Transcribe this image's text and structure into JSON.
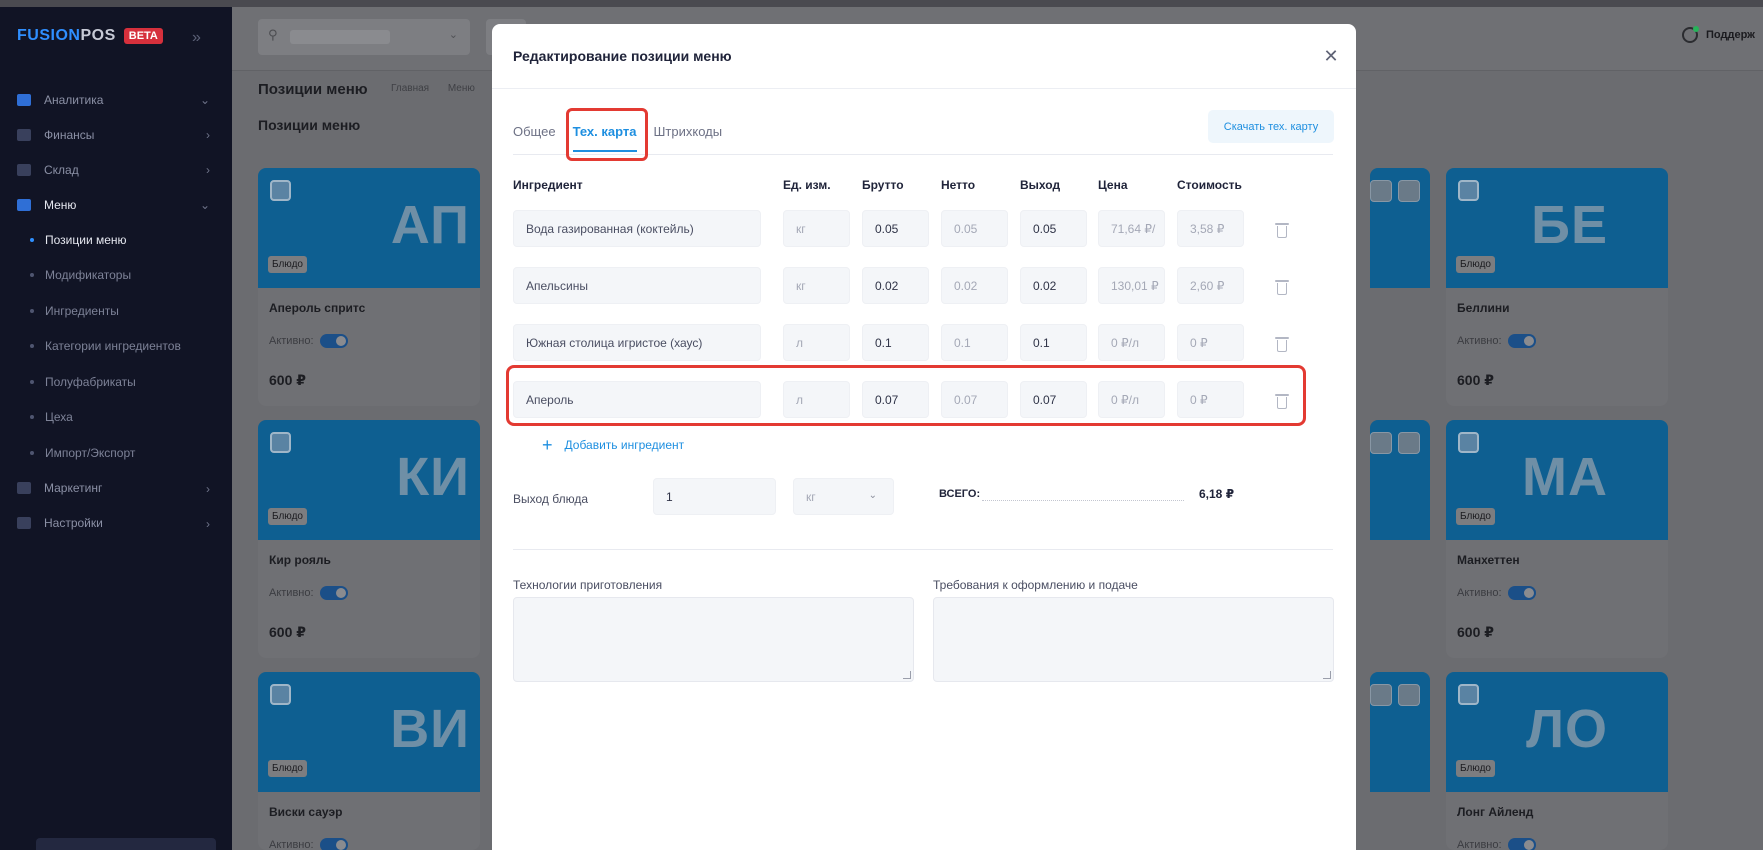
{
  "brand": {
    "name_a": "FUSION",
    "name_b": "POS",
    "badge": "BETA"
  },
  "sidebar": {
    "items": [
      {
        "label": "Аналитика",
        "arrow": "⌄"
      },
      {
        "label": "Финансы",
        "arrow": "›"
      },
      {
        "label": "Склад",
        "arrow": "›"
      },
      {
        "label": "Меню",
        "arrow": "⌄"
      }
    ],
    "sub_items": [
      "Позиции меню",
      "Модификаторы",
      "Ингредиенты",
      "Категории ингредиентов",
      "Полуфабрикаты",
      "Цеха",
      "Импорт/Экспорт"
    ],
    "items_after": [
      {
        "label": "Маркетинг",
        "arrow": "›"
      },
      {
        "label": "Настройки",
        "arrow": "›"
      }
    ]
  },
  "header": {
    "support": "Поддерж",
    "page_title": "Позиции меню",
    "breadcrumbs": [
      "Главная",
      "Меню"
    ],
    "section_title": "Позиции меню"
  },
  "cards": [
    {
      "letters": "АП",
      "badge": "Блюдо",
      "name": "Апероль спритс",
      "active_label": "Активно:",
      "price": "600 ₽"
    },
    {
      "letters": "БЕ",
      "badge": "Блюдо",
      "name": "Беллини",
      "active_label": "Активно:",
      "price": "600 ₽"
    },
    {
      "letters": "КИ",
      "badge": "Блюдо",
      "name": "Кир рояль",
      "active_label": "Активно:",
      "price": "600 ₽"
    },
    {
      "letters": "МА",
      "badge": "Блюдо",
      "name": "Манхеттен",
      "active_label": "Активно:",
      "price": "600 ₽"
    },
    {
      "letters": "ВИ",
      "badge": "Блюдо",
      "name": "Виски сауэр",
      "active_label": "Активно:"
    },
    {
      "letters": "ЛО",
      "badge": "Блюдо",
      "name": "Лонг Айленд",
      "active_label": "Активно:"
    }
  ],
  "modal": {
    "title": "Редактирование позиции меню",
    "close": "✕",
    "tabs": [
      "Общее",
      "Тех. карта",
      "Штрихкоды"
    ],
    "download": "Скачать тех. карту",
    "columns": [
      "Ингредиент",
      "Ед. изм.",
      "Брутто",
      "Нетто",
      "Выход",
      "Цена",
      "Стоимость"
    ],
    "rows": [
      {
        "ingredient": "Вода газированная (коктейль)",
        "unit": "кг",
        "gross": "0.05",
        "net": "0.05",
        "yield": "0.05",
        "price": "71,64 ₽/",
        "cost": "3,58 ₽"
      },
      {
        "ingredient": "Апельсины",
        "unit": "кг",
        "gross": "0.02",
        "net": "0.02",
        "yield": "0.02",
        "price": "130,01 ₽",
        "cost": "2,60 ₽"
      },
      {
        "ingredient": "Южная столица игристое (хаус)",
        "unit": "л",
        "gross": "0.1",
        "net": "0.1",
        "yield": "0.1",
        "price": "0 ₽/л",
        "cost": "0 ₽"
      },
      {
        "ingredient": "Апероль",
        "unit": "л",
        "gross": "0.07",
        "net": "0.07",
        "yield": "0.07",
        "price": "0 ₽/л",
        "cost": "0 ₽"
      }
    ],
    "add_ingredient": "Добавить ингредиент",
    "yield_label": "Выход блюда",
    "yield_value": "1",
    "yield_unit": "кг",
    "total_label": "ВСЕГО:",
    "total_value": "6,18 ₽",
    "tech_label": "Технологии приготовления",
    "serving_label": "Требования к оформлению и подаче"
  }
}
